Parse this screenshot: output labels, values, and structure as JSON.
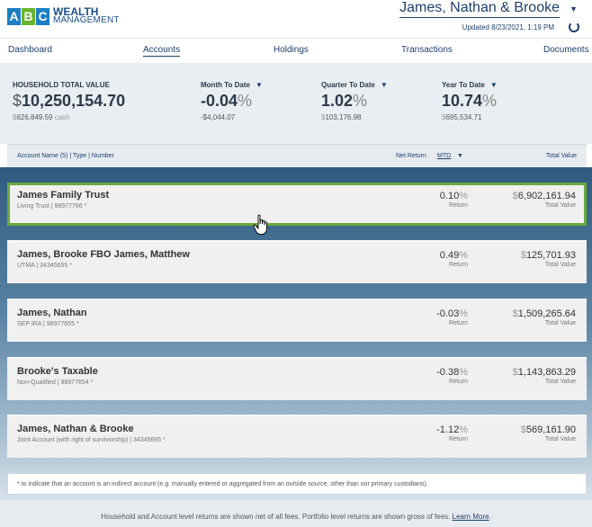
{
  "logo": {
    "letters": [
      "A",
      "B",
      "C"
    ],
    "line1": "WEALTH",
    "line2": "MANAGEMENT"
  },
  "header": {
    "household_name": "James, Nathan & Brooke",
    "updated": "Updated 8/23/2021, 1:19 PM"
  },
  "nav": [
    "Dashboard",
    "Accounts",
    "Holdings",
    "Transactions",
    "Documents"
  ],
  "summary": {
    "household": {
      "label": "HOUSEHOLD TOTAL VALUE",
      "currency": "$",
      "value": "10,250,154.70",
      "sub_currency": "$",
      "sub_value": "626,849.59",
      "sub_label": "cash"
    },
    "mtd": {
      "label": "Month To Date",
      "value": "-0.04",
      "pct": "%",
      "sub": "-$4,044.07"
    },
    "qtd": {
      "label": "Quarter To Date",
      "value": "1.02",
      "pct": "%",
      "sub_currency": "$",
      "sub": "103,176.98"
    },
    "ytd": {
      "label": "Year To Date",
      "value": "10.74",
      "pct": "%",
      "sub_currency": "$",
      "sub": "695,534.71"
    }
  },
  "table_header": {
    "account": "Account Name (5) | Type | Number",
    "net_return": "Net Return",
    "mtd": "MTD",
    "total": "Total Value"
  },
  "accounts": [
    {
      "name": "James Family Trust",
      "sub": "Living Trust | 98977766 *",
      "return": "0.10",
      "pct": "%",
      "return_label": "Return",
      "currency": "$",
      "value": "6,902,161.94",
      "value_label": "Total Value"
    },
    {
      "name": "James, Brooke FBO James, Matthew",
      "sub": "UTMA | 34345655 *",
      "return": "0.49",
      "pct": "%",
      "return_label": "Return",
      "currency": "$",
      "value": "125,701.93",
      "value_label": "Total Value"
    },
    {
      "name": "James, Nathan",
      "sub": "SEP IRA | 98977655 *",
      "return": "-0.03",
      "pct": "%",
      "return_label": "Return",
      "currency": "$",
      "value": "1,509,265.64",
      "value_label": "Total Value"
    },
    {
      "name": "Brooke's Taxable",
      "sub": "Non-Qualified | 98977654 *",
      "return": "-0.38",
      "pct": "%",
      "return_label": "Return",
      "currency": "$",
      "value": "1,143,863.29",
      "value_label": "Total Value"
    },
    {
      "name": "James, Nathan & Brooke",
      "sub": "Joint Account (with right of survivorship) | 34345665 *",
      "return": "-1.12",
      "pct": "%",
      "return_label": "Return",
      "currency": "$",
      "value": "569,161.90",
      "value_label": "Total Value"
    }
  ],
  "footnote": "* to indicate that an account is an indirect account (e.g. manually entered or aggregated from an outside source, other than our primary custodians).",
  "footer": {
    "text": "Household and Account level returns are shown net of all fees. Portfolio level returns are shown gross of fees.",
    "link": "Learn More"
  }
}
